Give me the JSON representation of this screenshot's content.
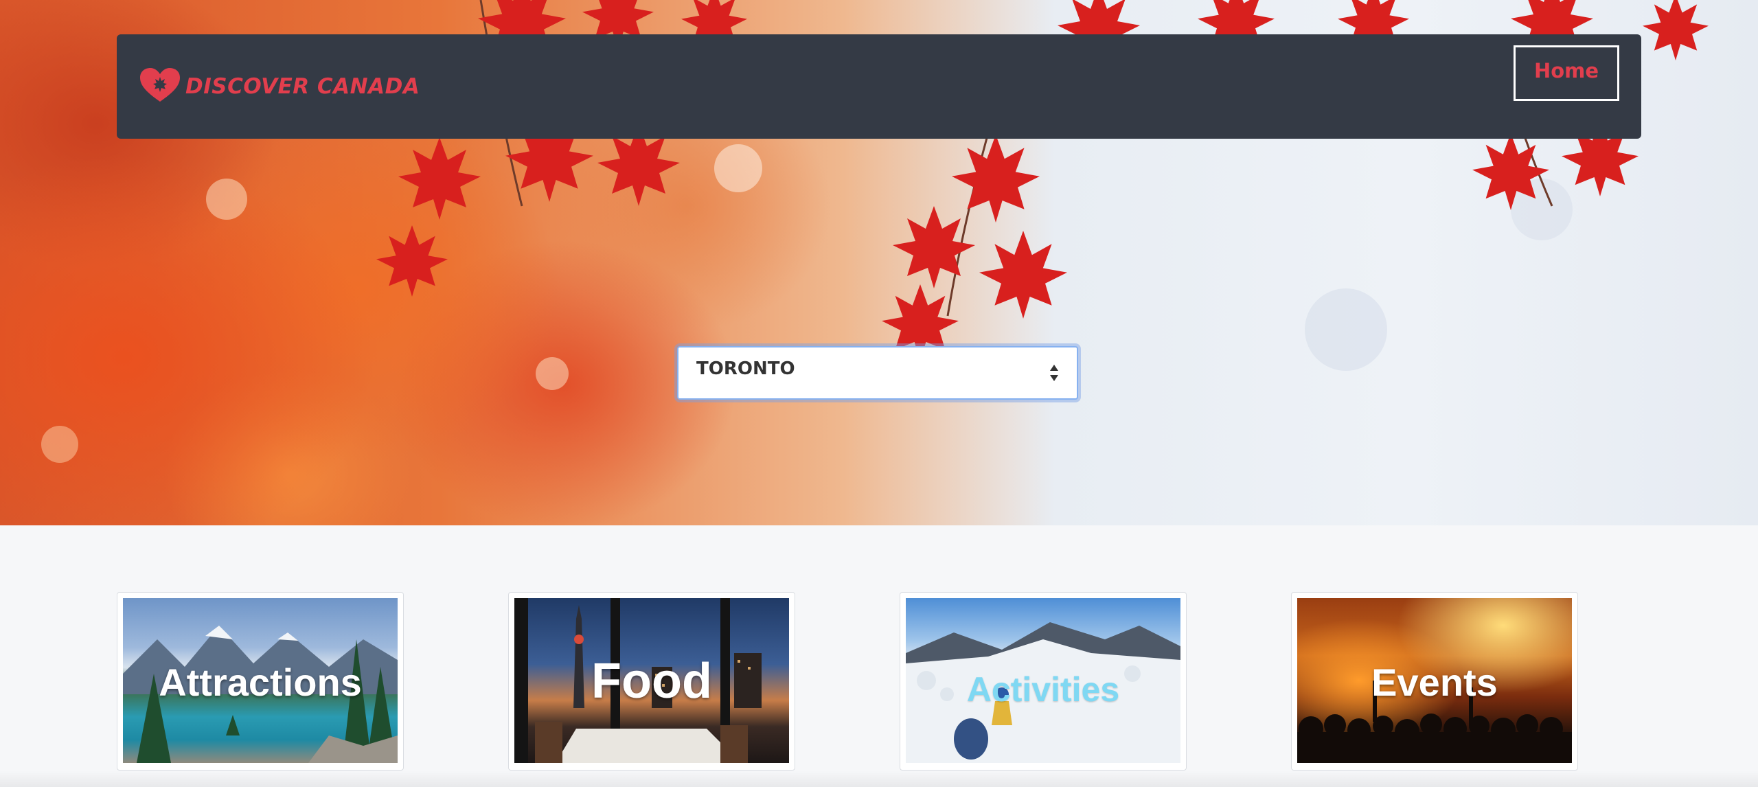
{
  "brand": {
    "name": "Discover Canada",
    "icon": "maple-heart-icon",
    "color": "#e23e4d"
  },
  "nav": {
    "home_label": "Home"
  },
  "city_select": {
    "selected": "Toronto",
    "icon": "sort-arrows-icon"
  },
  "categories": [
    {
      "label": "Attractions",
      "image": "lake-mountains"
    },
    {
      "label": "Food",
      "image": "cn-tower-restaurant"
    },
    {
      "label": "Activities",
      "image": "ski-slope"
    },
    {
      "label": "Events",
      "image": "concert-crowd"
    }
  ],
  "colors": {
    "navbar": "#343a45",
    "accent": "#e23e4d",
    "page_bg": "#f6f7f9"
  }
}
